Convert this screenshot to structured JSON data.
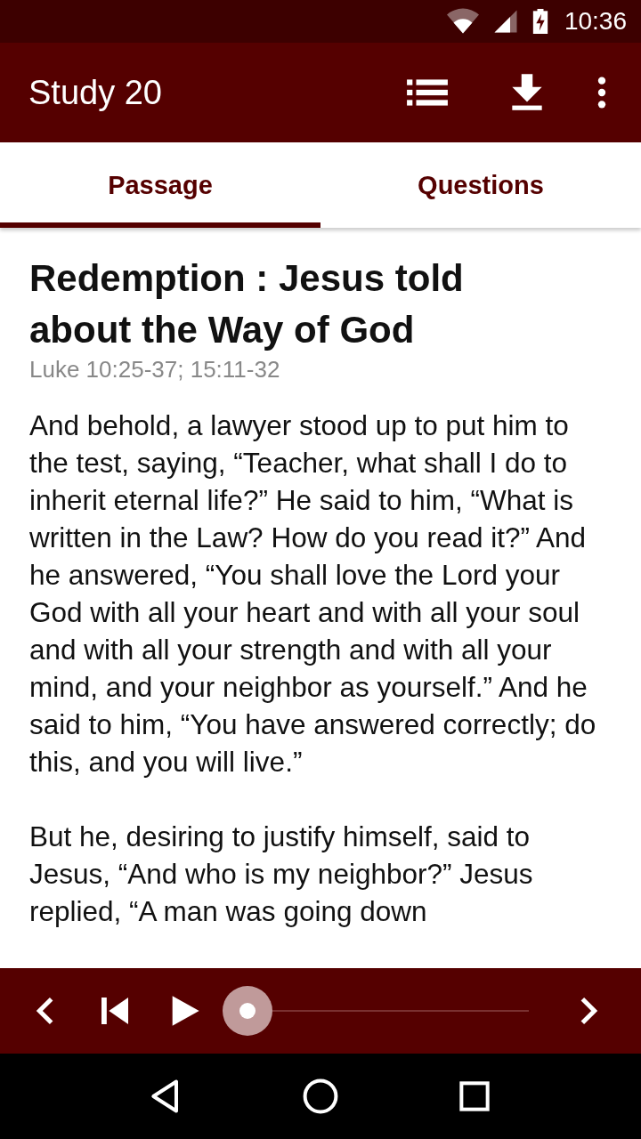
{
  "status_bar": {
    "time": "10:36"
  },
  "app_bar": {
    "title": "Study 20"
  },
  "tabs": [
    {
      "label": "Passage",
      "selected": true
    },
    {
      "label": "Questions",
      "selected": false
    }
  ],
  "passage": {
    "title": "Redemption : Jesus told about the Way of God",
    "reference": "Luke 10:25-37; 15:11-32",
    "paragraphs": [
      "And behold, a lawyer stood up to put him to the test, saying, “Teacher, what shall I do to inherit eternal life?” He said to him, “What is written in the Law? How do you read it?” And he answered, “You shall love the Lord your God with all your heart and with all your soul and with all your strength and with all your mind, and your neighbor as yourself.” And he said to him, “You have answered correctly; do this, and you will live.”",
      "But he, desiring to justify himself, said to Jesus, “And who is my neighbor?” Jesus replied, “A man was going down"
    ]
  },
  "player": {
    "level": 0
  }
}
